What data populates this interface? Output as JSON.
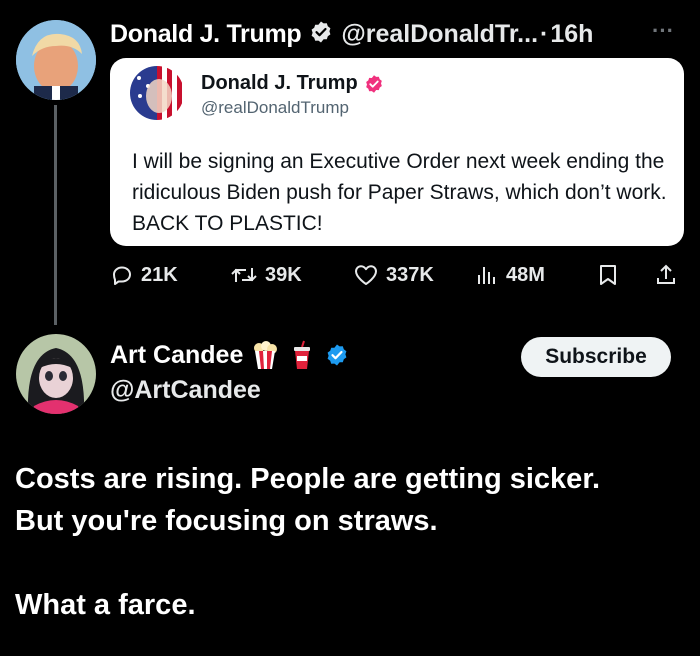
{
  "original_tweet": {
    "author_name": "Donald J. Trump",
    "author_handle": "@realDonaldTr...",
    "separator": "·",
    "time": "16h",
    "more_label": "···"
  },
  "quoted_tweet": {
    "author_name": "Donald J. Trump",
    "author_handle": "@realDonaldTrump",
    "text": "I will be signing an Executive Order next week ending the ridiculous Biden push for Paper Straws, which don’t work. BACK TO PLASTIC!"
  },
  "actions": {
    "replies": "21K",
    "retweets": "39K",
    "likes": "337K",
    "views": "48M"
  },
  "reply": {
    "author_name": "Art Candee",
    "author_handle": "@ArtCandee",
    "subscribe_label": "Subscribe",
    "lines": [
      "Costs are rising. People are getting sicker.",
      "But you're focusing on straws.",
      "What a farce."
    ]
  },
  "colors": {
    "background": "#000000",
    "verified_blue": "#1d9bf0",
    "verified_pink": "#f0317e",
    "muted": "#71767b"
  }
}
